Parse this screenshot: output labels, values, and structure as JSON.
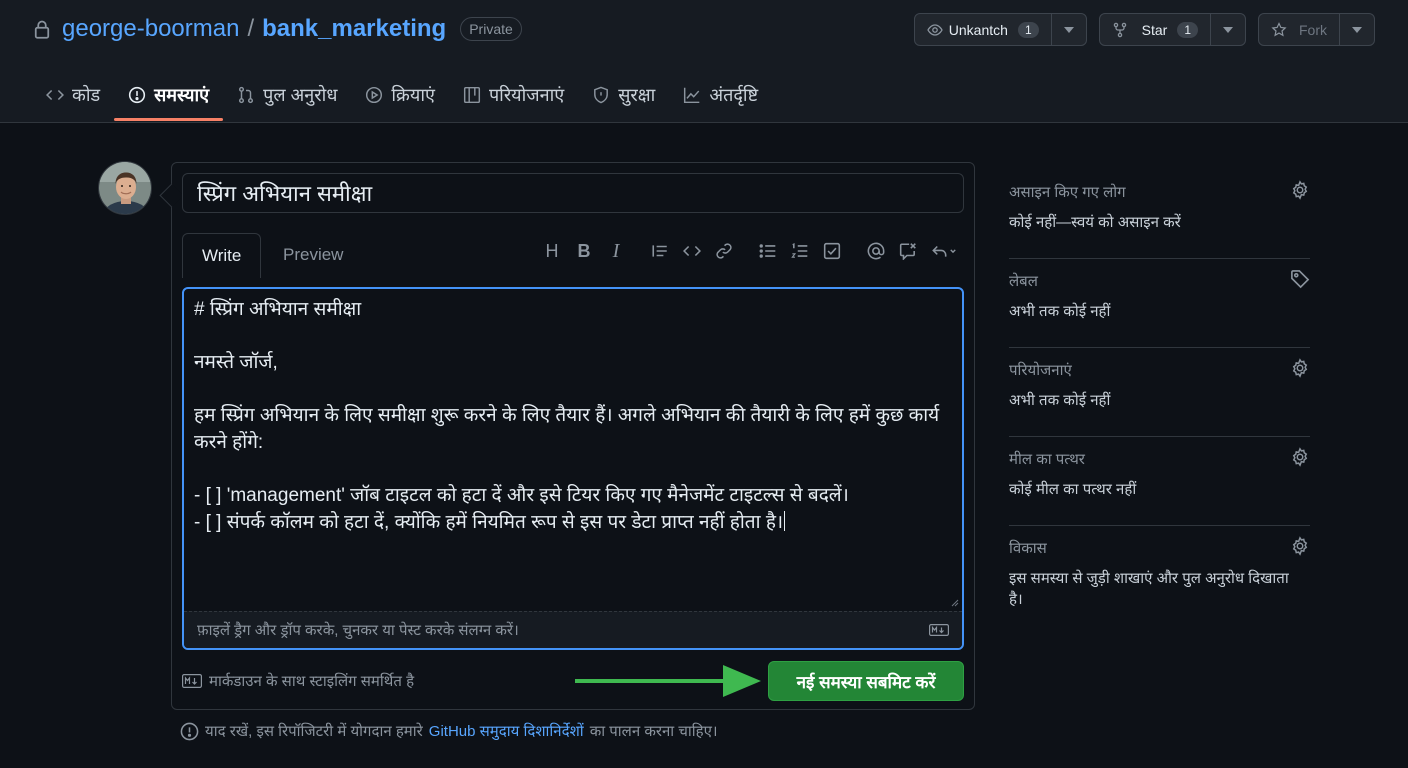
{
  "repo": {
    "owner": "george-boorman",
    "separator": "/",
    "name": "bank_marketing",
    "visibility": "Private"
  },
  "actions": {
    "watch": {
      "label": "Unkantch",
      "count": "1"
    },
    "star": {
      "label": "Star",
      "count": "1"
    },
    "fork": {
      "label": "Fork"
    }
  },
  "tabs": [
    {
      "label": "कोड",
      "icon": "code-icon"
    },
    {
      "label": "समस्याएं",
      "icon": "issue-icon",
      "active": true
    },
    {
      "label": "पुल अनुरोध",
      "icon": "pull-request-icon"
    },
    {
      "label": "क्रियाएं",
      "icon": "play-icon"
    },
    {
      "label": "परियोजनाएं",
      "icon": "table-icon"
    },
    {
      "label": "सुरक्षा",
      "icon": "shield-icon"
    },
    {
      "label": "अंतर्दृष्टि",
      "icon": "graph-icon"
    }
  ],
  "issue": {
    "title": "स्प्रिंग अभियान समीक्षा",
    "write_tab": "Write",
    "preview_tab": "Preview",
    "toolbar": [
      "H",
      "B",
      "I",
      "quote-icon",
      "code-icon",
      "link-icon",
      "unordered-list-icon",
      "ordered-list-icon",
      "tasklist-icon",
      "mention-icon",
      "reference-icon",
      "undo-icon"
    ],
    "body_lines": [
      "# स्प्रिंग अभियान समीक्षा",
      "",
      "नमस्ते जॉर्ज,",
      "",
      "हम स्प्रिंग अभियान के लिए समीक्षा शुरू करने के लिए तैयार हैं। अगले अभियान की तैयारी के लिए हमें कुछ कार्य",
      "करने होंगे:",
      "",
      "- [ ] 'management' जॉब टाइटल को हटा दें और इसे टियर किए गए मैनेजमेंट टाइटल्स से बदलें।",
      "- [ ] संपर्क कॉलम को हटा दें, क्योंकि हमें नियमित रूप से इस पर डेटा प्राप्त नहीं होता है।"
    ],
    "attach_hint": "फ़ाइलें ड्रैग और ड्रॉप करके, चुनकर या पेस्ट करके संलग्न करें।",
    "markdown_note": "मार्कडाउन के साथ स्टाइलिंग समर्थित है",
    "submit_label": "नई समस्या सबमिट करें"
  },
  "guideline": {
    "prefix": "याद रखें, इस रिपॉजिटरी में योगदान हमारे",
    "link": "GitHub समुदाय दिशानिर्देशों",
    "suffix": "का पालन करना चाहिए।"
  },
  "sidebar": [
    {
      "heading": "असाइन किए गए लोग",
      "value": "कोई नहीं—स्वयं को असाइन करें",
      "icon": "gear-icon"
    },
    {
      "heading": "लेबल",
      "value": "अभी तक कोई नहीं",
      "icon": "tag-icon"
    },
    {
      "heading": "परियोजनाएं",
      "value": "अभी तक कोई नहीं",
      "icon": "gear-icon"
    },
    {
      "heading": "मील का पत्थर",
      "value": "कोई मील का पत्थर नहीं",
      "icon": "gear-icon"
    },
    {
      "heading": "विकास",
      "value": "इस समस्या से जुड़ी शाखाएं और पुल अनुरोध दिखाता है।",
      "icon": "gear-icon"
    }
  ],
  "colors": {
    "background": "#0d1117",
    "link": "#58a6ff",
    "accent_underline": "#f78166",
    "submit_green": "#238636",
    "focus_blue": "#4493f8",
    "arrow_green": "#3fb950"
  }
}
